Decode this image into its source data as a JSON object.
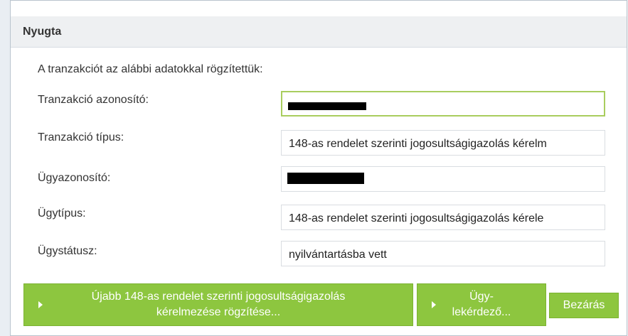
{
  "dialog": {
    "title": "Nyugta",
    "intro": "A tranzakciót az alábbi adatokkal rögzítettük:"
  },
  "fields": [
    {
      "label": "Tranzakció azonosító:",
      "value": "",
      "redacted": true
    },
    {
      "label": "Tranzakció típus:",
      "value": "148-as rendelet szerinti jogosultságigazolás kérelm",
      "redacted": false
    },
    {
      "label": "Ügyazonosító:",
      "value": "",
      "redacted": true
    },
    {
      "label": "Ügytípus:",
      "value": "148-as rendelet szerinti jogosultságigazolás kérele",
      "redacted": false
    },
    {
      "label": "Ügystátusz:",
      "value": "nyilvántartásba vett",
      "redacted": false
    }
  ],
  "buttons": {
    "new_request_line1": "Újabb 148-as rendelet szerinti jogosultságigazolás",
    "new_request_line2": "kérelmezése rögzítése...",
    "case_query_line1": "Ügy-",
    "case_query_line2": "lekérdező...",
    "close": "Bezárás"
  },
  "colors": {
    "button_green": "#8dc63f",
    "focus_border": "#a9cd5e",
    "header_bg": "#eef0f2"
  }
}
